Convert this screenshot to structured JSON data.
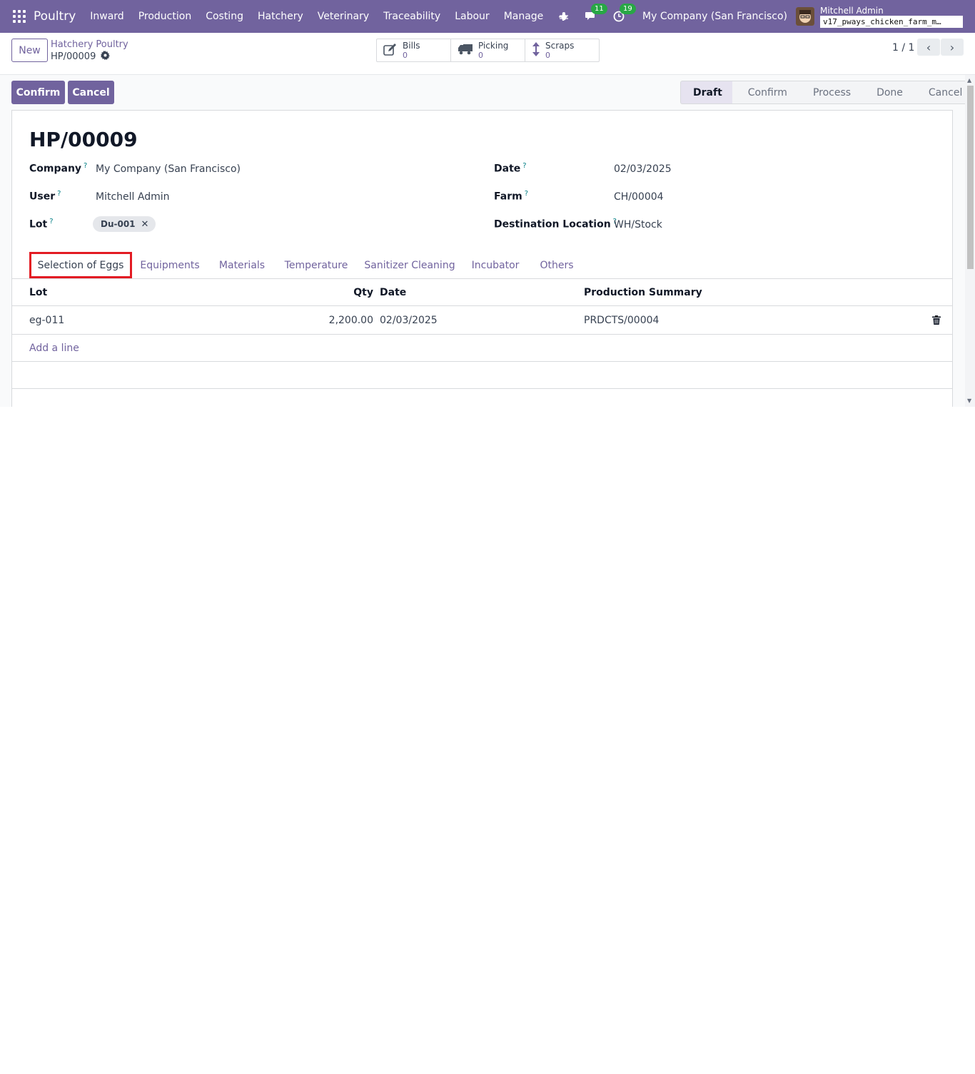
{
  "navbar": {
    "brand": "Poultry",
    "menu": [
      "Inward",
      "Production",
      "Costing",
      "Hatchery",
      "Veterinary",
      "Traceability",
      "Labour",
      "Manage"
    ],
    "messages_count": "11",
    "activities_count": "19",
    "company": "My Company (San Francisco)",
    "user_name": "Mitchell Admin",
    "database": "v17_pways_chicken_farm_m…"
  },
  "control": {
    "new_label": "New",
    "breadcrumb": "Hatchery Poultry",
    "record_name": "HP/00009",
    "smart_buttons": [
      {
        "label": "Bills",
        "value": "0"
      },
      {
        "label": "Picking",
        "value": "0"
      },
      {
        "label": "Scraps",
        "value": "0"
      }
    ],
    "pager": "1 / 1"
  },
  "actions": {
    "confirm_label": "Confirm",
    "cancel_label": "Cancel"
  },
  "status_steps": [
    "Draft",
    "Confirm",
    "Process",
    "Done",
    "Cancel"
  ],
  "record": {
    "title": "HP/00009",
    "company_label": "Company",
    "company_value": "My Company (San Francisco)",
    "user_label": "User",
    "user_value": "Mitchell Admin",
    "lot_label": "Lot",
    "lot_tag": "Du-001",
    "date_label": "Date",
    "date_value": "02/03/2025",
    "farm_label": "Farm",
    "farm_value": "CH/00004",
    "destination_label": "Destination Location",
    "destination_value": "WH/Stock",
    "help_mark": "?"
  },
  "tabs": [
    "Selection of Eggs",
    "Equipments",
    "Materials",
    "Temperature",
    "Sanitizer Cleaning",
    "Incubator",
    "Others"
  ],
  "table": {
    "headers": [
      "Lot",
      "Qty",
      "Date",
      "Production Summary"
    ],
    "rows": [
      {
        "lot": "eg-011",
        "qty": "2,200.00",
        "date": "02/03/2025",
        "summary": "PRDCTS/00004"
      }
    ],
    "add_line": "Add a line"
  },
  "colors": {
    "brand": "#71639e",
    "highlight": "#e31b23",
    "badge": "#28a745"
  }
}
